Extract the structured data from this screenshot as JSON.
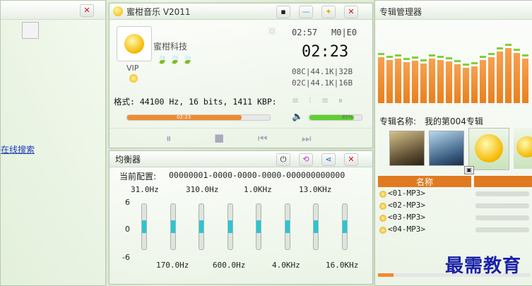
{
  "left_panel": {
    "close_label": "✕",
    "online_search": "在线搜索"
  },
  "player": {
    "title": "蜜柑音乐 V2011",
    "buttons": {
      "minimize": "▪",
      "line": "—",
      "star": "✦",
      "close": "✕"
    },
    "brand": "蜜柑科技",
    "vip": "VIP",
    "overlay_close": "✕",
    "time_small": "02:57",
    "mode": "M0|E0",
    "time_large": "02:23",
    "format_line1": "08C|44.1K|32B",
    "format_line2": "02C|44.1K|16B",
    "format_info": "格式: 44100 Hz, 16 bits, 1411 KBP:",
    "progress_label": "02:23",
    "progress_fraction": 0.8,
    "volume_label": "85%",
    "volume_fraction": 0.85,
    "controls": {
      "pause": "⏸",
      "stop": "■",
      "prev": "⏮",
      "next": "⏭"
    }
  },
  "equalizer": {
    "title": "均衡器",
    "config_label": "当前配置:",
    "config_value": "00000001-0000-0000-0000-000000000000",
    "top_freqs": [
      "31.0Hz",
      "310.0Hz",
      "1.0KHz",
      "13.0KHz"
    ],
    "bottom_freqs": [
      "170.0Hz",
      "600.0Hz",
      "4.0KHz",
      "16.0KHz"
    ],
    "scale": [
      "6",
      "0",
      "-6"
    ],
    "bands": [
      0,
      0,
      0,
      0,
      0,
      0,
      0,
      0
    ],
    "buttons": {
      "power": "⏻",
      "reset": "⟲",
      "share": "⋖",
      "close": "✕"
    }
  },
  "album": {
    "title": "专辑管理器",
    "name_label": "专辑名称:",
    "name_value": "我的第004专辑",
    "column_header": "名称",
    "items": [
      "<01-MP3>",
      "<02-MP3>",
      "<03-MP3>",
      "<04-MP3>"
    ],
    "spectrum": [
      0.62,
      0.58,
      0.6,
      0.55,
      0.57,
      0.53,
      0.6,
      0.58,
      0.56,
      0.52,
      0.48,
      0.5,
      0.58,
      0.62,
      0.7,
      0.74,
      0.68,
      0.6
    ]
  },
  "watermark": "最需教育"
}
